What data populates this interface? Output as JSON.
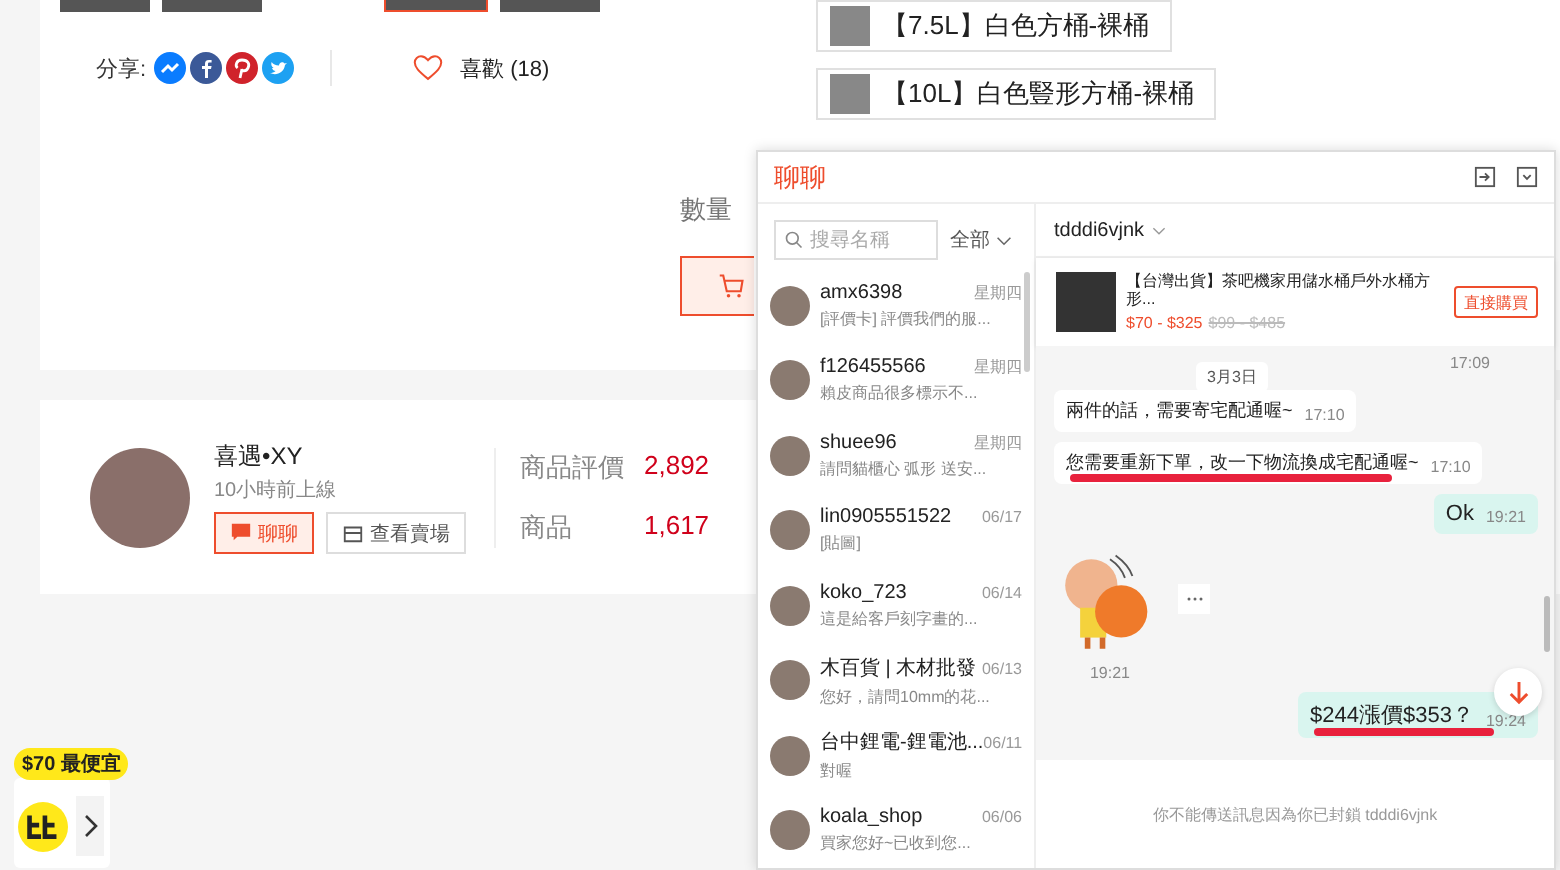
{
  "share": {
    "label": "分享:"
  },
  "like": {
    "label": "喜歡 (18)",
    "liked": false
  },
  "variants": [
    {
      "label": "【7.5L】白色方桶-裸桶",
      "selected": false
    },
    {
      "label": "【10L】白色豎形方桶-裸桶",
      "selected": false
    }
  ],
  "quantity_label": "數量",
  "seller": {
    "name": "喜遇•XY",
    "status": "10小時前上線",
    "chat_button": "聊聊",
    "shop_button": "查看賣場",
    "stats": [
      {
        "label": "商品評價",
        "value": "2,892"
      },
      {
        "label": "商品",
        "value": "1,617"
      }
    ]
  },
  "promo": {
    "badge": "$70 最便宜"
  },
  "chat": {
    "title": "聊聊",
    "search": {
      "placeholder": "搜尋名稱"
    },
    "filter": "全部",
    "conversations": [
      {
        "name": "amx6398",
        "date": "星期四",
        "preview": "[評價卡] 評價我們的服..."
      },
      {
        "name": "f126455566",
        "date": "星期四",
        "preview": "賴皮商品很多標示不..."
      },
      {
        "name": "shuee96",
        "date": "星期四",
        "preview": "請問貓櫃心 弧形 送安..."
      },
      {
        "name": "lin0905551522",
        "date": "06/17",
        "preview": "[貼圖]"
      },
      {
        "name": "koko_723",
        "date": "06/14",
        "preview": "這是給客戶刻字畫的..."
      },
      {
        "name": "木百貨 | 木材批發",
        "date": "06/13",
        "preview": "您好，請問10mm的花..."
      },
      {
        "name": "台中鋰電-鋰電池...",
        "date": "06/11",
        "preview": "對喔"
      },
      {
        "name": "koala_shop",
        "date": "06/06",
        "preview": "買家您好~已收到您..."
      }
    ],
    "contact": "tdddi6vjnk",
    "product": {
      "title": "【台灣出貨】茶吧機家用儲水桶戶外水桶方形...",
      "price": "$70 - $325",
      "original_price": "$99 - $485",
      "buy_button": "直接購買"
    },
    "messages": [
      {
        "kind": "time",
        "text": "17:09"
      },
      {
        "kind": "date",
        "text": "3月3日"
      },
      {
        "kind": "incoming",
        "text": "兩件的話，需要寄宅配通喔~",
        "time": "17:10",
        "marked": false
      },
      {
        "kind": "incoming",
        "text": "您需要重新下單，改一下物流換成宅配通喔~",
        "time": "17:10",
        "marked": true
      },
      {
        "kind": "outgoing",
        "text": "Ok",
        "time": "19:21",
        "marked": false
      },
      {
        "kind": "sticker",
        "time": "19:21"
      },
      {
        "kind": "outgoing",
        "text": "$244漲價$353？",
        "time": "19:24",
        "marked": true
      }
    ],
    "notice": "你不能傳送訊息因為你已封鎖 tdddi6vjnk"
  }
}
